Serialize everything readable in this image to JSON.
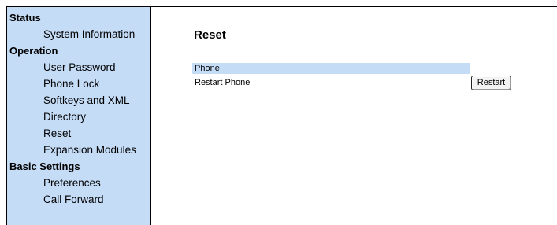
{
  "sidebar": {
    "sections": [
      {
        "title": "Status",
        "items": [
          "System Information"
        ]
      },
      {
        "title": "Operation",
        "items": [
          "User Password",
          "Phone Lock",
          "Softkeys and XML",
          "Directory",
          "Reset",
          "Expansion Modules"
        ]
      },
      {
        "title": "Basic Settings",
        "items": [
          "Preferences",
          "Call Forward"
        ]
      }
    ]
  },
  "main": {
    "title": "Reset",
    "section_header": "Phone",
    "rows": [
      {
        "label": "Restart Phone",
        "button_label": "Restart"
      }
    ]
  },
  "colors": {
    "sidebar_bg": "#c5dcf7",
    "section_bar_bg": "#c5dcf7"
  }
}
